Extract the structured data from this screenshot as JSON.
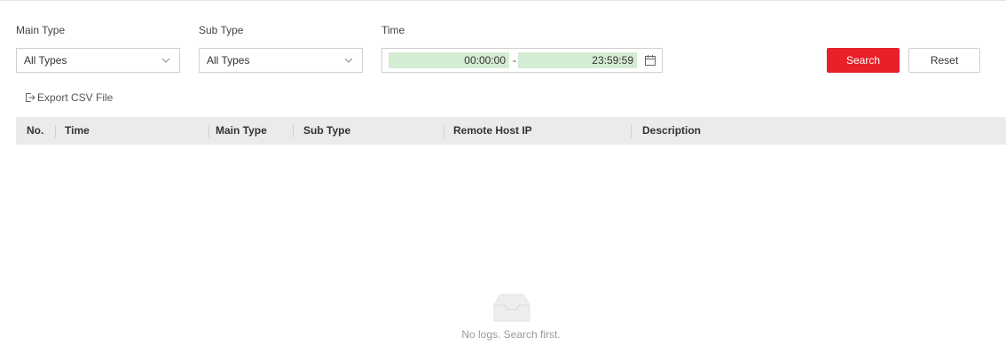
{
  "filters": {
    "main_type_label": "Main Type",
    "main_type_value": "All Types",
    "sub_type_label": "Sub Type",
    "sub_type_value": "All Types",
    "time_label": "Time",
    "time_start": "00:00:00",
    "time_separator": "-",
    "time_end": "23:59:59"
  },
  "actions": {
    "search_label": "Search",
    "reset_label": "Reset",
    "export_label": "Export CSV File"
  },
  "table": {
    "columns": [
      "No.",
      "Time",
      "Main Type",
      "Sub Type",
      "Remote Host IP",
      "Description"
    ],
    "rows": []
  },
  "empty_state": {
    "message": "No logs. Search first.",
    "icon": "inbox-icon"
  },
  "colors": {
    "accent": "#e8202a",
    "time_field_bg": "#d4ecd3",
    "header_bg": "#ebebeb"
  }
}
